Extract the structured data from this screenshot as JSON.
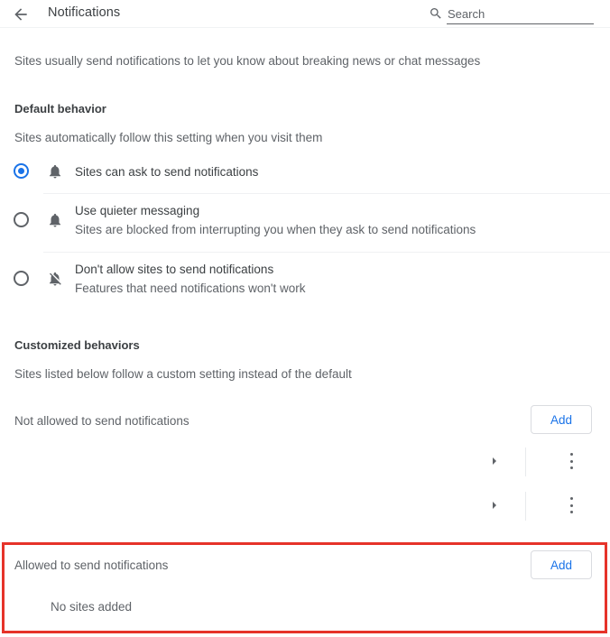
{
  "header": {
    "back_icon": "arrow-left-icon",
    "title": "Notifications",
    "search": {
      "icon": "search-icon",
      "placeholder": "Search",
      "value": ""
    }
  },
  "intro_text": "Sites usually send notifications to let you know about breaking news or chat messages",
  "default_behavior": {
    "heading": "Default behavior",
    "subtext": "Sites automatically follow this setting when you visit them",
    "options": [
      {
        "id": "sites-can-ask",
        "icon": "bell-icon",
        "label": "Sites can ask to send notifications",
        "description": "",
        "selected": true
      },
      {
        "id": "quieter-messaging",
        "icon": "bell-icon",
        "label": "Use quieter messaging",
        "description": "Sites are blocked from interrupting you when they ask to send notifications",
        "selected": false
      },
      {
        "id": "dont-allow",
        "icon": "bell-off-icon",
        "label": "Don't allow sites to send notifications",
        "description": "Features that need notifications won't work",
        "selected": false
      }
    ]
  },
  "customized_behaviors": {
    "heading": "Customized behaviors",
    "subtext": "Sites listed below follow a custom setting instead of the default",
    "not_allowed": {
      "label": "Not allowed to send notifications",
      "add_label": "Add",
      "rows": [
        {
          "name": "",
          "expand_icon": "chevron-right-icon",
          "menu_icon": "more-vert-icon"
        },
        {
          "name": "",
          "expand_icon": "chevron-right-icon",
          "menu_icon": "more-vert-icon"
        }
      ]
    },
    "allowed": {
      "label": "Allowed to send notifications",
      "add_label": "Add",
      "empty_text": "No sites added",
      "highlighted": true,
      "highlight_color": "#e63329"
    }
  },
  "colors": {
    "accent": "#1a73e8",
    "text_primary": "#3c4043",
    "text_secondary": "#5f6368",
    "border": "#dadce0",
    "divider": "#f0f1f3",
    "highlight": "#e63329"
  }
}
